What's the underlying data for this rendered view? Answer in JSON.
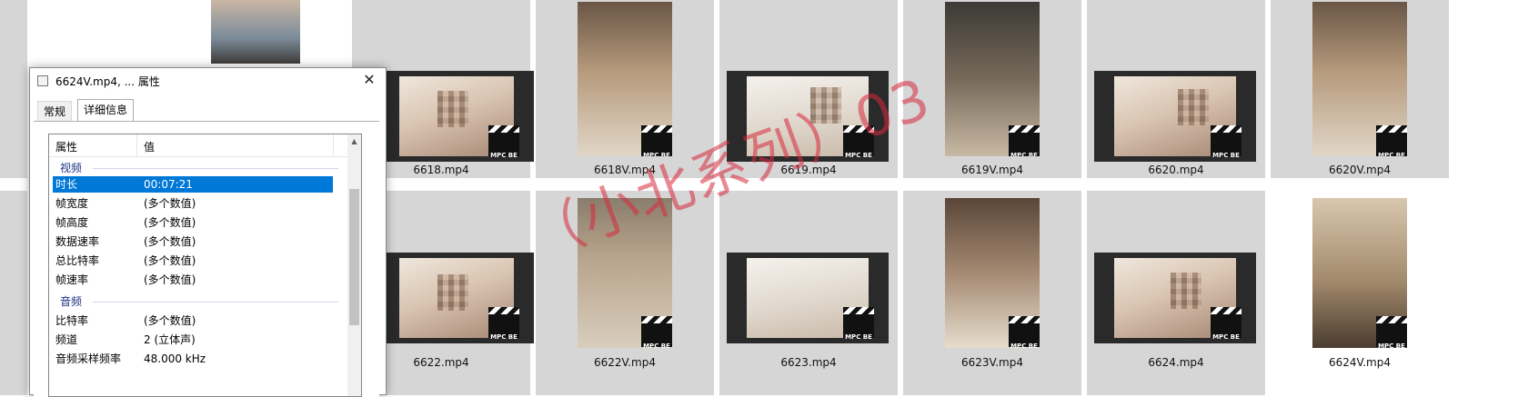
{
  "files": {
    "row1": [
      "6618.mp4",
      "6618V.mp4",
      "6619.mp4",
      "6619V.mp4",
      "6620.mp4",
      "6620V.mp4"
    ],
    "row2": [
      "6622.mp4",
      "6622V.mp4",
      "6623.mp4",
      "6623V.mp4",
      "6624.mp4",
      "6624V.mp4"
    ],
    "badge": "MPC BE"
  },
  "dialog": {
    "title": "6624V.mp4, ... 属性",
    "close": "✕",
    "tabs": [
      "常规",
      "详细信息"
    ],
    "columns": {
      "property": "属性",
      "value": "值"
    },
    "groups": {
      "video": "视频",
      "audio": "音频"
    },
    "video_rows": [
      {
        "k": "时长",
        "v": "00:07:21"
      },
      {
        "k": "帧宽度",
        "v": "(多个数值)"
      },
      {
        "k": "帧高度",
        "v": "(多个数值)"
      },
      {
        "k": "数据速率",
        "v": "(多个数值)"
      },
      {
        "k": "总比特率",
        "v": "(多个数值)"
      },
      {
        "k": "帧速率",
        "v": "(多个数值)"
      }
    ],
    "audio_rows": [
      {
        "k": "比特率",
        "v": "(多个数值)"
      },
      {
        "k": "频道",
        "v": "2 (立体声)"
      },
      {
        "k": "音频采样频率",
        "v": "48.000 kHz"
      }
    ]
  },
  "watermark": "（小北系列）03"
}
